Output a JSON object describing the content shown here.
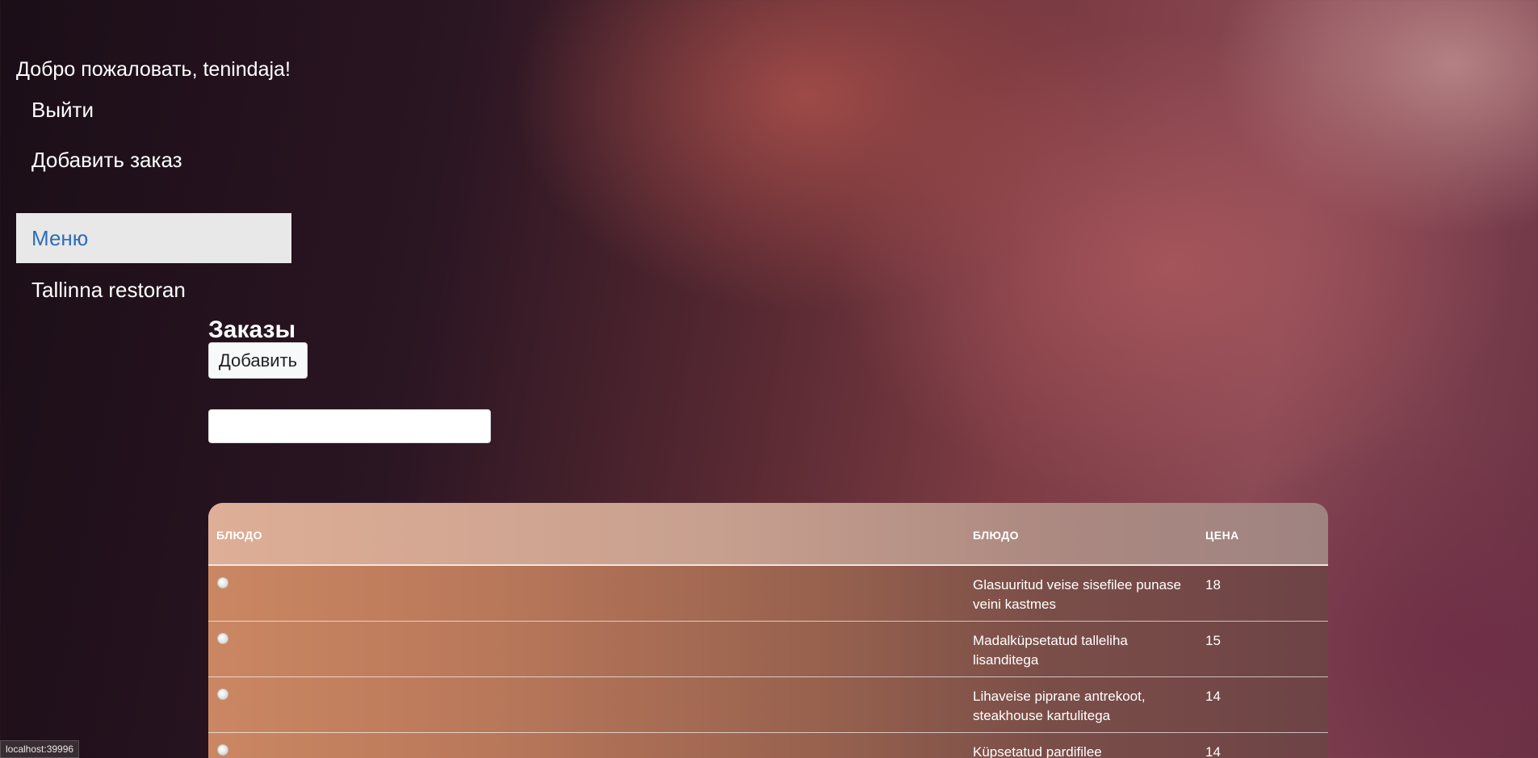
{
  "sidebar": {
    "welcome": "Добро пожаловать, tenindaja!",
    "logout": "Выйти",
    "add_order": "Добавить заказ",
    "menu": "Меню",
    "restaurant": "Tallinna restoran"
  },
  "main": {
    "title": "Заказы",
    "add_button": "Добавить",
    "search_value": ""
  },
  "table": {
    "headers": [
      "БЛЮДО",
      "БЛЮДО",
      "ЦЕНА"
    ],
    "rows": [
      {
        "dish": "Glasuuritud veise sisefilee punase veini kastmes",
        "price": "18"
      },
      {
        "dish": "Madalküpsetatud talleliha lisanditega",
        "price": "15"
      },
      {
        "dish": "Lihaveise piprane antrekoot, steakhouse kartulitega",
        "price": "14"
      },
      {
        "dish": "Küpsetatud pardifilee",
        "price": "14"
      }
    ]
  },
  "status_bar": {
    "url": "localhost:39996"
  },
  "colors": {
    "menu_active_bg": "#e8e8e8",
    "menu_active_text": "#2f6db5"
  }
}
